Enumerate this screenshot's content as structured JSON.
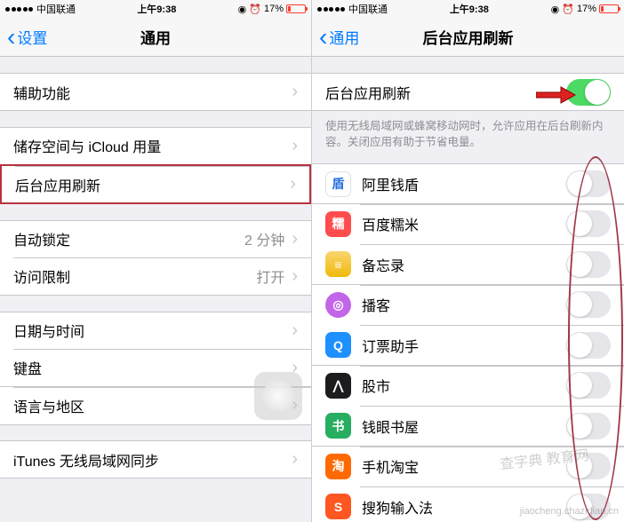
{
  "status": {
    "carrier": "中国联通",
    "time": "上午9:38",
    "alarm_icon": "⏰",
    "lock_icon": "🔘",
    "battery_percent": "17%"
  },
  "left": {
    "nav": {
      "back_label": "设置",
      "title": "通用"
    },
    "rows": {
      "accessibility": "辅助功能",
      "storage": "储存空间与 iCloud 用量",
      "background_refresh": "后台应用刷新",
      "auto_lock": "自动锁定",
      "auto_lock_value": "2 分钟",
      "restrictions": "访问限制",
      "restrictions_value": "打开",
      "date_time": "日期与时间",
      "keyboard": "键盘",
      "language_region": "语言与地区",
      "itunes_wifi": "iTunes 无线局域网同步"
    }
  },
  "right": {
    "nav": {
      "back_label": "通用",
      "title": "后台应用刷新"
    },
    "master_label": "后台应用刷新",
    "footer": "使用无线局域网或蜂窝移动网时，允许应用在后台刷新内容。关闭应用有助于节省电量。",
    "apps": [
      {
        "name": "阿里钱盾",
        "icon_text": "盾"
      },
      {
        "name": "百度糯米",
        "icon_text": "糯"
      },
      {
        "name": "备忘录",
        "icon_text": "≡"
      },
      {
        "name": "播客",
        "icon_text": "◎"
      },
      {
        "name": "订票助手",
        "icon_text": "Q"
      },
      {
        "name": "股市",
        "icon_text": "⋀"
      },
      {
        "name": "钱眼书屋",
        "icon_text": "书"
      },
      {
        "name": "手机淘宝",
        "icon_text": "淘"
      },
      {
        "name": "搜狗输入法",
        "icon_text": "S"
      }
    ]
  },
  "watermark1": "查字典 教育网",
  "watermark2": "jiaocheng.chazidian.cn"
}
